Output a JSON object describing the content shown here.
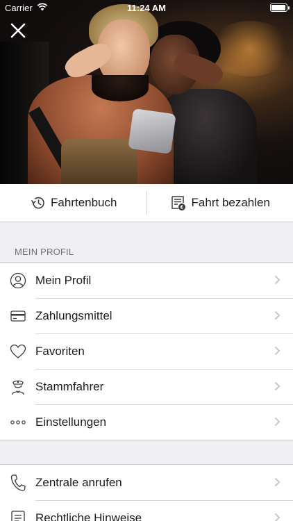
{
  "status_bar": {
    "carrier": "Carrier",
    "time": "11:24 AM",
    "battery_level": 0.95
  },
  "header": {
    "close_icon": "close-icon"
  },
  "actions": {
    "logbook": {
      "label": "Fahrtenbuch",
      "icon": "history-icon"
    },
    "pay": {
      "label": "Fahrt bezahlen",
      "icon": "receipt-icon"
    }
  },
  "profile_section": {
    "title": "MEIN PROFIL",
    "items": [
      {
        "label": "Mein Profil",
        "icon": "user-icon"
      },
      {
        "label": "Zahlungsmittel",
        "icon": "credit-card-icon"
      },
      {
        "label": "Favoriten",
        "icon": "heart-icon"
      },
      {
        "label": "Stammfahrer",
        "icon": "driver-icon"
      },
      {
        "label": "Einstellungen",
        "icon": "more-icon"
      }
    ]
  },
  "support_section": {
    "items": [
      {
        "label": "Zentrale anrufen",
        "icon": "phone-icon"
      },
      {
        "label": "Rechtliche Hinweise",
        "icon": "document-icon"
      }
    ]
  },
  "colors": {
    "icon_gray": "#3a3a3c",
    "chevron": "#c7c7cc",
    "background": "#efeff4"
  }
}
